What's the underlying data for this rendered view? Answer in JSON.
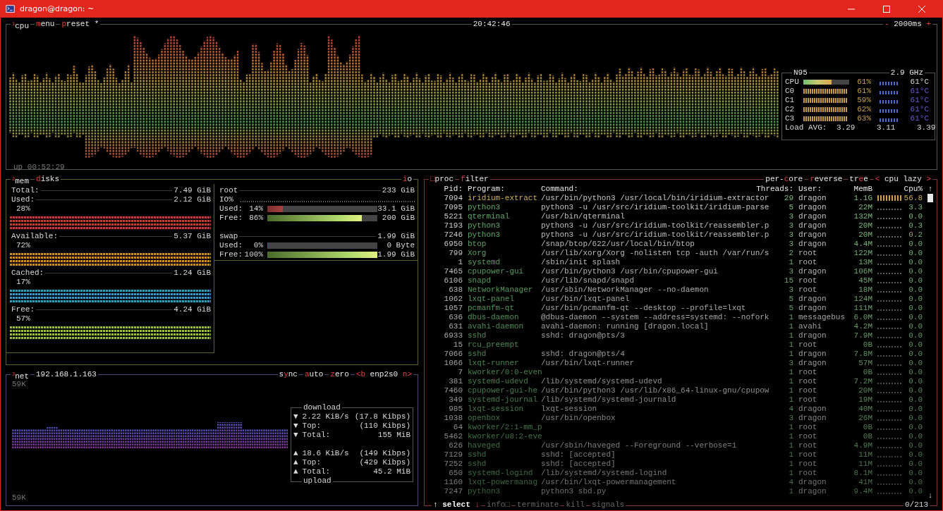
{
  "window": {
    "title": "dragon@dragon: ~"
  },
  "cpu": {
    "title": "$^{1}$cpu",
    "buttons": [
      [
        {
          "t": "m",
          "hot": true
        },
        {
          "t": "enu",
          "hot": false
        }
      ],
      [
        {
          "t": "p",
          "hot": true
        },
        {
          "t": "reset *",
          "hot": false
        }
      ]
    ],
    "clock": "20:42:46",
    "interval": [
      {
        "t": "-",
        "hot": true
      },
      {
        "t": " 2000ms ",
        "hot": false
      },
      {
        "t": "+",
        "hot": true
      }
    ],
    "uptime": "up 00:52:29",
    "info": {
      "name": "N95",
      "freq": "2.9 GHz",
      "total": {
        "label": "CPU",
        "level": 0.61,
        "percent": "61%",
        "temp": "61°C"
      },
      "cores": [
        {
          "label": "C0",
          "percent": "61%",
          "temp": "61°C"
        },
        {
          "label": "C1",
          "percent": "59%",
          "temp": "61°C"
        },
        {
          "label": "C2",
          "percent": "62%",
          "temp": "61°C"
        },
        {
          "label": "C3",
          "percent": "63%",
          "temp": "61°C"
        }
      ],
      "load": {
        "label": "Load AVG:",
        "values": [
          "3.29",
          "3.11",
          "3.39"
        ]
      }
    }
  },
  "mem": {
    "title": "$^{2}$mem",
    "items": [
      {
        "label": "Total:",
        "value": "7.49 GiB"
      },
      {
        "label": "Used:",
        "value": "2.12 GiB",
        "percent": "28%",
        "color": "#b8423c"
      },
      {
        "label": "Available:",
        "value": "5.37 GiB",
        "percent": "72%",
        "color": "#c9922a"
      },
      {
        "label": "Cached:",
        "value": "1.24 GiB",
        "percent": "17%",
        "color": "#3a9cc4"
      },
      {
        "label": "Free:",
        "value": "4.24 GiB",
        "percent": "57%",
        "color": "#9bc04a"
      }
    ]
  },
  "disks": {
    "title": [
      {
        "t": "d",
        "hot": true
      },
      {
        "t": "isks",
        "hot": false
      }
    ],
    "io": [
      {
        "t": "i",
        "hot": true
      },
      {
        "t": "o",
        "hot": false
      }
    ],
    "volumes": [
      {
        "name": "root",
        "size": "233 GiB",
        "io_label": "IO%",
        "meters": [
          {
            "kind": "used",
            "label": "Used:",
            "percent": " 14%",
            "level": 0.14,
            "value": "33.1 GiB"
          },
          {
            "kind": "free",
            "label": "Free:",
            "percent": " 86%",
            "level": 0.86,
            "value": "200 GiB"
          }
        ]
      },
      {
        "name": "swap",
        "size": "1.99 GiB",
        "meters": [
          {
            "kind": "used",
            "label": "Used:",
            "percent": "  0%",
            "level": 0,
            "value": "0 Byte"
          },
          {
            "kind": "free",
            "label": "Free:",
            "percent": "100%",
            "level": 1,
            "value": "1.99 GiB"
          }
        ]
      }
    ]
  },
  "net": {
    "title": "$^{3}$net",
    "address": "192.168.1.163",
    "buttons": [
      [
        {
          "t": "s",
          "hot": false
        },
        {
          "t": "y",
          "hot": true
        },
        {
          "t": "nc",
          "hot": false
        }
      ],
      [
        {
          "t": "a",
          "hot": true
        },
        {
          "t": "uto",
          "hot": false
        }
      ],
      [
        {
          "t": "z",
          "hot": true
        },
        {
          "t": "ero",
          "hot": false
        }
      ],
      [
        {
          "t": "<b",
          "hot": true
        },
        {
          "t": " enp2s0 ",
          "hot": false
        },
        {
          "t": "n>",
          "hot": true
        }
      ]
    ],
    "scale_top": "59K",
    "scale_bottom": "59K",
    "download": {
      "title": "download",
      "rows": [
        {
          "arrow": "▼",
          "label": "2.22 KiB/s",
          "value": "(17.8 Kibps)"
        },
        {
          "arrow": "▼",
          "label": "Top:",
          "value": "(110 Kibps)"
        },
        {
          "arrow": "▼",
          "label": "Total:",
          "value": "155 MiB"
        }
      ]
    },
    "upload": {
      "title": "upload",
      "rows": [
        {
          "arrow": "▲",
          "label": "18.6 KiB/s",
          "value": "(149 Kibps)"
        },
        {
          "arrow": "▲",
          "label": "Top:",
          "value": "(429 Kibps)"
        },
        {
          "arrow": "▲",
          "label": "Total:",
          "value": "45.2 MiB"
        }
      ]
    }
  },
  "proc": {
    "title": [
      {
        "t": "□",
        "hot": true
      },
      {
        "t": "proc",
        "hot": false
      }
    ],
    "filter": [
      {
        "t": "f",
        "hot": true
      },
      {
        "t": "ilter",
        "hot": false
      }
    ],
    "options": [
      [
        {
          "t": "per-",
          "hot": false
        },
        {
          "t": "c",
          "hot": true
        },
        {
          "t": "ore",
          "hot": false
        }
      ],
      [
        {
          "t": "r",
          "hot": true
        },
        {
          "t": "everse",
          "hot": false
        }
      ],
      [
        {
          "t": "tr",
          "hot": false
        },
        {
          "t": "e",
          "hot": true
        },
        {
          "t": "e",
          "hot": false
        }
      ],
      [
        {
          "t": "<",
          "hot": true
        },
        {
          "t": " cpu lazy ",
          "hot": false
        },
        {
          "t": ">",
          "hot": true
        }
      ]
    ],
    "columns": [
      "Pid:",
      "Program:",
      "Command:",
      "Threads:",
      "User:",
      "MemB",
      "Cpu%"
    ],
    "rows": [
      [
        "7094",
        "iridium-extract",
        "/usr/bin/python3 /usr/local/bin/iridium-extractor",
        "29",
        "dragon",
        "1.1G",
        "56.8"
      ],
      [
        "7095",
        "python3",
        "python3 -u /usr/src/iridium-toolkit/iridium-parse",
        "5",
        "dragon",
        "22M",
        "3.3"
      ],
      [
        "5221",
        "qterminal",
        "/usr/bin/qterminal",
        "3",
        "dragon",
        "132M",
        "0.0"
      ],
      [
        "7193",
        "python3",
        "python3 -u /usr/src/iridium-toolkit/reassembler.p",
        "3",
        "dragon",
        "20M",
        "0.3"
      ],
      [
        "7246",
        "python3",
        "python3 -u /usr/src/iridium-toolkit/reassembler.p",
        "3",
        "dragon",
        "20M",
        "0.2"
      ],
      [
        "6950",
        "btop",
        "/snap/btop/622/usr/local/bin/btop",
        "3",
        "dragon",
        "4.4M",
        "0.0"
      ],
      [
        "799",
        "Xorg",
        "/usr/lib/xorg/Xorg -nolisten tcp -auth /var/run/s",
        "2",
        "root",
        "122M",
        "0.0"
      ],
      [
        "1",
        "systemd",
        "/sbin/init splash",
        "1",
        "root",
        "13M",
        "0.0"
      ],
      [
        "7465",
        "cpupower-gui",
        "/usr/bin/python3 /usr/bin/cpupower-gui",
        "3",
        "dragon",
        "106M",
        "0.0"
      ],
      [
        "6106",
        "snapd",
        "/usr/lib/snapd/snapd",
        "15",
        "root",
        "45M",
        "0.0"
      ],
      [
        "638",
        "NetworkManager",
        "/usr/sbin/NetworkManager --no-daemon",
        "3",
        "root",
        "18M",
        "0.0"
      ],
      [
        "1062",
        "lxqt-panel",
        "/usr/bin/lxqt-panel",
        "5",
        "dragon",
        "124M",
        "0.0"
      ],
      [
        "1057",
        "pcmanfm-qt",
        "/usr/bin/pcmanfm-qt --desktop --profile=lxqt",
        "5",
        "dragon",
        "111M",
        "0.0"
      ],
      [
        "636",
        "dbus-daemon",
        "@dbus-daemon --system --address=systemd: --nofork",
        "1",
        "messagebus",
        "6.0M",
        "0.0"
      ],
      [
        "631",
        "avahi-daemon",
        "avahi-daemon: running [dragon.local]",
        "1",
        "avahi",
        "4.2M",
        "0.0"
      ],
      [
        "6933",
        "sshd",
        "sshd: dragon@pts/3",
        "1",
        "dragon",
        "7.9M",
        "0.0"
      ],
      [
        "15",
        "rcu_preempt",
        "",
        "1",
        "root",
        "0B",
        "0.0"
      ],
      [
        "7066",
        "sshd",
        "sshd: dragon@pts/4",
        "1",
        "dragon",
        "7.8M",
        "0.0"
      ],
      [
        "1066",
        "lxqt-runner",
        "/usr/bin/lxqt-runner",
        "3",
        "dragon",
        "57M",
        "0.0"
      ],
      [
        "7",
        "kworker/0:0-even",
        "",
        "1",
        "root",
        "0B",
        "0.0"
      ],
      [
        "381",
        "systemd-udevd",
        "/lib/systemd/systemd-udevd",
        "1",
        "root",
        "7.2M",
        "0.0"
      ],
      [
        "7460",
        "cpupower-gui-he",
        "/usr/bin/python3 /usr/lib/x86_64-linux-gnu/cpupow",
        "1",
        "root",
        "20M",
        "0.0"
      ],
      [
        "349",
        "systemd-journal",
        "/lib/systemd/systemd-journald",
        "1",
        "root",
        "19M",
        "0.0"
      ],
      [
        "985",
        "lxqt-session",
        "lxqt-session",
        "4",
        "dragon",
        "40M",
        "0.0"
      ],
      [
        "1038",
        "openbox",
        "/usr/bin/openbox",
        "3",
        "dragon",
        "26M",
        "0.0"
      ],
      [
        "64",
        "kworker/2:1-mm_p",
        "",
        "1",
        "root",
        "0B",
        "0.0"
      ],
      [
        "5462",
        "kworker/u8:2-eve",
        "",
        "1",
        "root",
        "0B",
        "0.0"
      ],
      [
        "626",
        "haveged",
        "/usr/sbin/haveged --Foreground --verbose=1",
        "1",
        "root",
        "4.9M",
        "0.0"
      ],
      [
        "7129",
        "sshd",
        "sshd: [accepted]",
        "1",
        "root",
        "11M",
        "0.0"
      ],
      [
        "7252",
        "sshd",
        "sshd: [accepted]",
        "1",
        "root",
        "11M",
        "0.0"
      ],
      [
        "650",
        "systemd-logind",
        "/lib/systemd/systemd-logind",
        "1",
        "root",
        "8.1M",
        "0.0"
      ],
      [
        "1160",
        "lxqt-powermanag",
        "/usr/bin/lxqt-powermanagement",
        "4",
        "dragon",
        "41M",
        "0.0"
      ],
      [
        "7247",
        "python3",
        "python3 sbd.py",
        "1",
        "dragon",
        "9.4M",
        "0.0"
      ]
    ],
    "scroll": {
      "up": "↑",
      "down": "↓"
    },
    "select": {
      "up": "↑",
      "label": "select",
      "down": "↓"
    },
    "actions": [
      {
        "label": "info",
        "glyph": "□",
        "disabled": true
      },
      {
        "label": "terminate",
        "disabled": true
      },
      {
        "label": "kill",
        "disabled": true
      },
      {
        "label": "signals",
        "disabled": true
      }
    ],
    "count": "0/213"
  }
}
